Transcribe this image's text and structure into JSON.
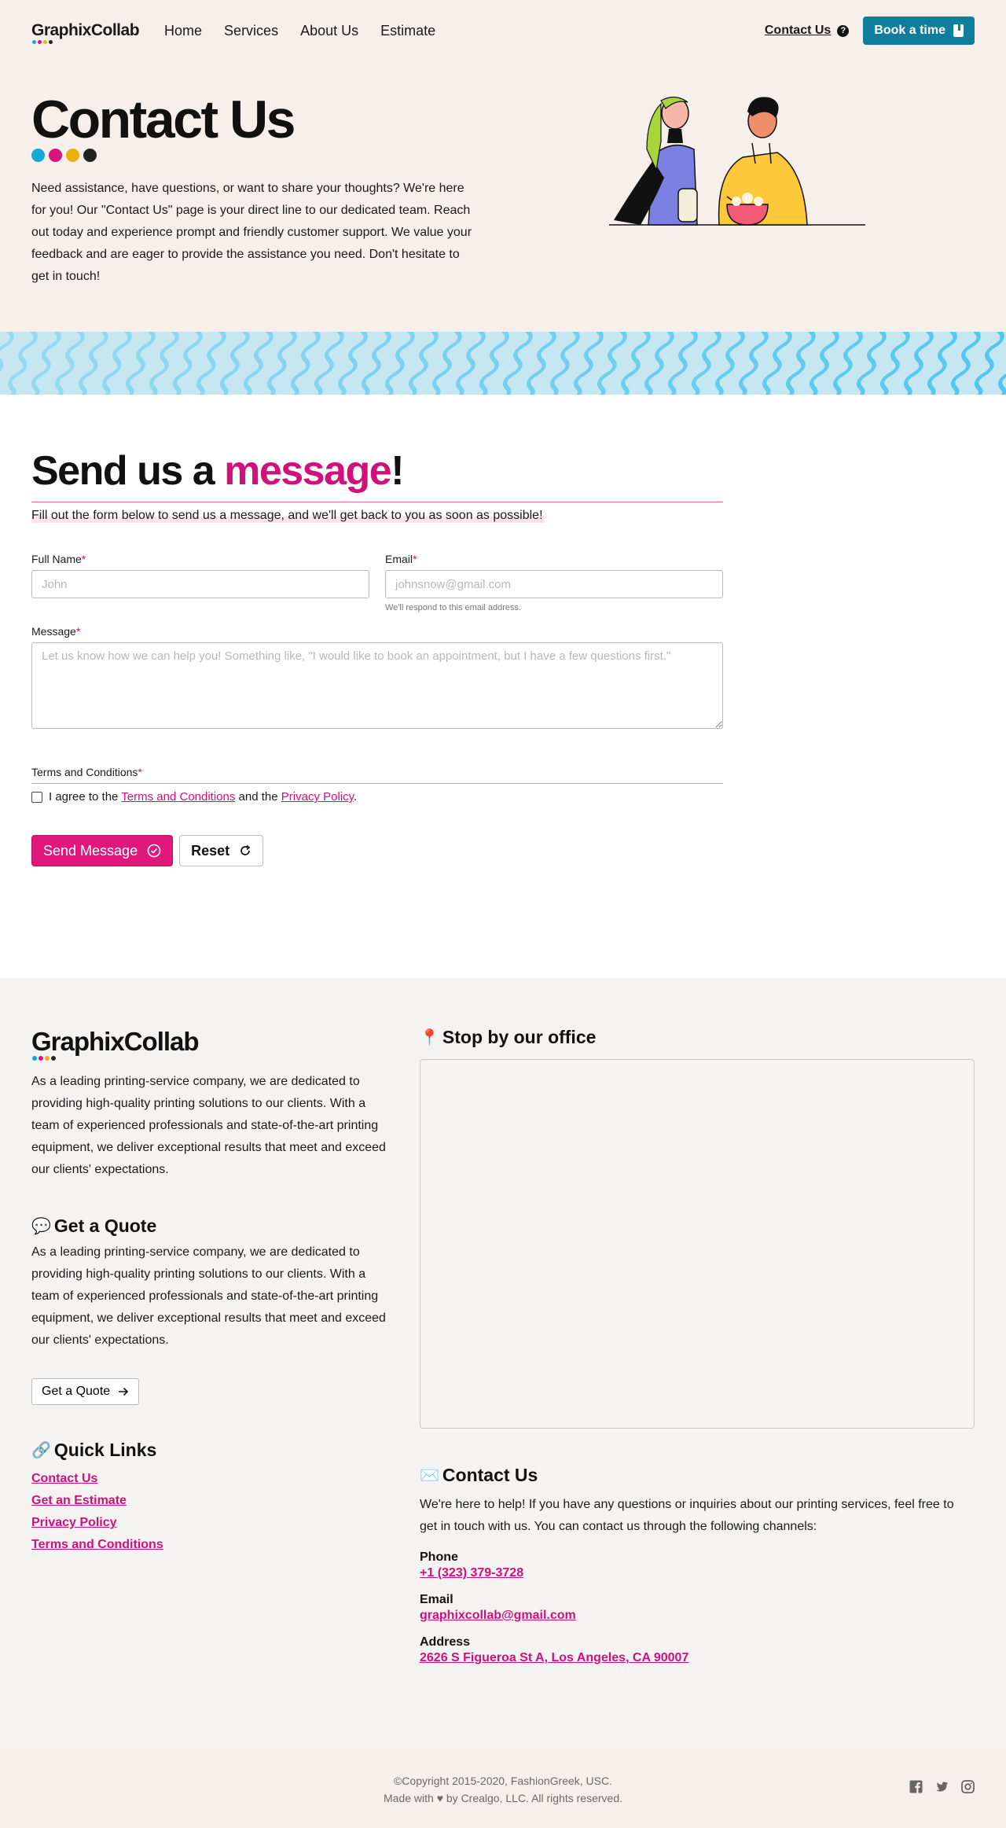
{
  "brand": {
    "name": "GraphixCollab"
  },
  "nav": {
    "links": [
      "Home",
      "Services",
      "About Us",
      "Estimate"
    ],
    "contact_label": "Contact Us",
    "help_symbol": "?",
    "book_label": "Book a time"
  },
  "hero": {
    "title": "Contact Us",
    "text": "Need assistance, have questions, or want to share your thoughts? We're here for you! Our \"Contact Us\" page is your direct line to our dedicated team. Reach out today and experience prompt and friendly customer support. We value your feedback and are eager to provide the assistance you need. Don't hesitate to get in touch!"
  },
  "form": {
    "title_pre": "Send us a ",
    "title_accent": "message",
    "title_post": "!",
    "subtitle": "Fill out the form below to send us a message, and we'll get back to you as soon as possible!",
    "full_name": {
      "label": "Full Name",
      "placeholder": "John",
      "value": ""
    },
    "email": {
      "label": "Email",
      "placeholder": "johnsnow@gmail.com",
      "value": "",
      "hint": "We'll respond to this email address."
    },
    "message": {
      "label": "Message",
      "placeholder": "Let us know how we can help you! Something like, \"I would like to book an appointment, but I have a few questions first.\"",
      "value": ""
    },
    "required_mark": "*",
    "terms": {
      "label": "Terms and Conditions",
      "agree_pre": "I agree to the ",
      "terms_link": "Terms and Conditions",
      "agree_mid": " and the ",
      "privacy_link": "Privacy Policy",
      "agree_post": ".",
      "checked": false
    },
    "send_label": "Send Message",
    "reset_label": "Reset"
  },
  "footer": {
    "about_text": "As a leading printing-service company, we are dedicated to providing high-quality printing solutions to our clients. With a team of experienced professionals and state-of-the-art printing equipment, we deliver exceptional results that meet and exceed our clients' expectations.",
    "quote": {
      "heading": "Get a Quote",
      "text": "As a leading printing-service company, we are dedicated to providing high-quality printing solutions to our clients. With a team of experienced professionals and state-of-the-art printing equipment, we deliver exceptional results that meet and exceed our clients' expectations.",
      "button": "Get a Quote"
    },
    "quick_links": {
      "heading": "Quick Links",
      "items": [
        "Contact Us",
        "Get an Estimate",
        "Privacy Policy",
        "Terms and Conditions"
      ]
    },
    "office": {
      "heading": "Stop by our office"
    },
    "contact": {
      "heading": "Contact Us",
      "text": "We're here to help! If you have any questions or inquiries about our printing services, feel free to get in touch with us. You can contact us through the following channels:",
      "phone_label": "Phone",
      "phone": "+1 (323) 379-3728",
      "email_label": "Email",
      "email": "graphixcollab@gmail.com",
      "address_label": "Address",
      "address": "2626 S Figueroa St A, Los Angeles, CA 90007"
    }
  },
  "bottom": {
    "copyright": "©Copyright 2015-2020, FashionGreek, USC.",
    "made_pre": "Made with",
    "made_post": "by Crealgo, LLC. All rights reserved.",
    "socials": [
      "facebook-icon",
      "twitter-icon",
      "instagram-icon"
    ]
  },
  "colors": {
    "accent": "#d0117a",
    "button_pink": "#e0187c",
    "teal": "#0f7e9c",
    "hero_bg": "#f6efec",
    "footer_bg": "#f4f3f2",
    "cyan": "#12a9d6",
    "magenta": "#d8157e",
    "yellow": "#e8b10c",
    "black": "#222222"
  }
}
